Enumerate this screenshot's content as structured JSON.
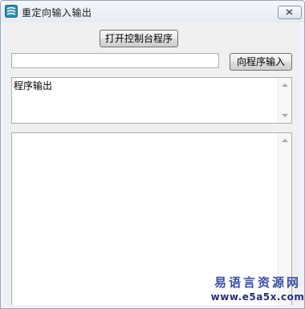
{
  "window": {
    "title": "重定向输入输出",
    "app_icon": "app-logo-icon",
    "close_icon": "close-icon"
  },
  "buttons": {
    "open_console": "打开控制台程序",
    "send_input": "向程序输入"
  },
  "input": {
    "value": ""
  },
  "output_box_1": {
    "text": "程序输出"
  },
  "output_box_2": {
    "text": ""
  },
  "watermark": {
    "brand": "易语言资源网",
    "url": "www.e5a5x.com"
  },
  "colors": {
    "watermark_text": "#3a4fa8",
    "client_bg": "#f0f0f0",
    "title_bg": "#e6ecf4"
  }
}
